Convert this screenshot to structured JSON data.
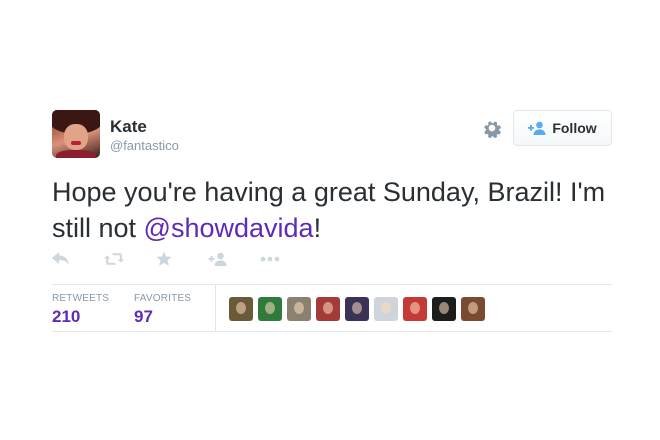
{
  "user": {
    "full_name": "Kate",
    "username": "@fantastico"
  },
  "follow_button": {
    "label": "Follow"
  },
  "tweet": {
    "text_before": "Hope you're having a great Sunday, Brazil! I'm still not ",
    "mention": "@showdavida",
    "text_after": "!"
  },
  "actions": [
    "reply-icon",
    "retweet-icon",
    "favorite-icon",
    "follow-icon",
    "more-icon"
  ],
  "stats": {
    "retweets_label": "RETWEETS",
    "retweets_value": "210",
    "favorites_label": "FAVORITES",
    "favorites_value": "97"
  },
  "colors": {
    "mention": "#5f2ab8",
    "stat_value": "#5f2ab8",
    "follow_icon": "#55acee",
    "muted": "#8899a6"
  },
  "favoriters": [
    {
      "color": "#6b5a3a"
    },
    {
      "color": "#2f7a3c"
    },
    {
      "color": "#8a8170"
    },
    {
      "color": "#a33b3b"
    },
    {
      "color": "#3b3357"
    },
    {
      "color": "#cfd3da"
    },
    {
      "color": "#c43a36"
    },
    {
      "color": "#1d1d1d"
    },
    {
      "color": "#7a4a32"
    }
  ]
}
